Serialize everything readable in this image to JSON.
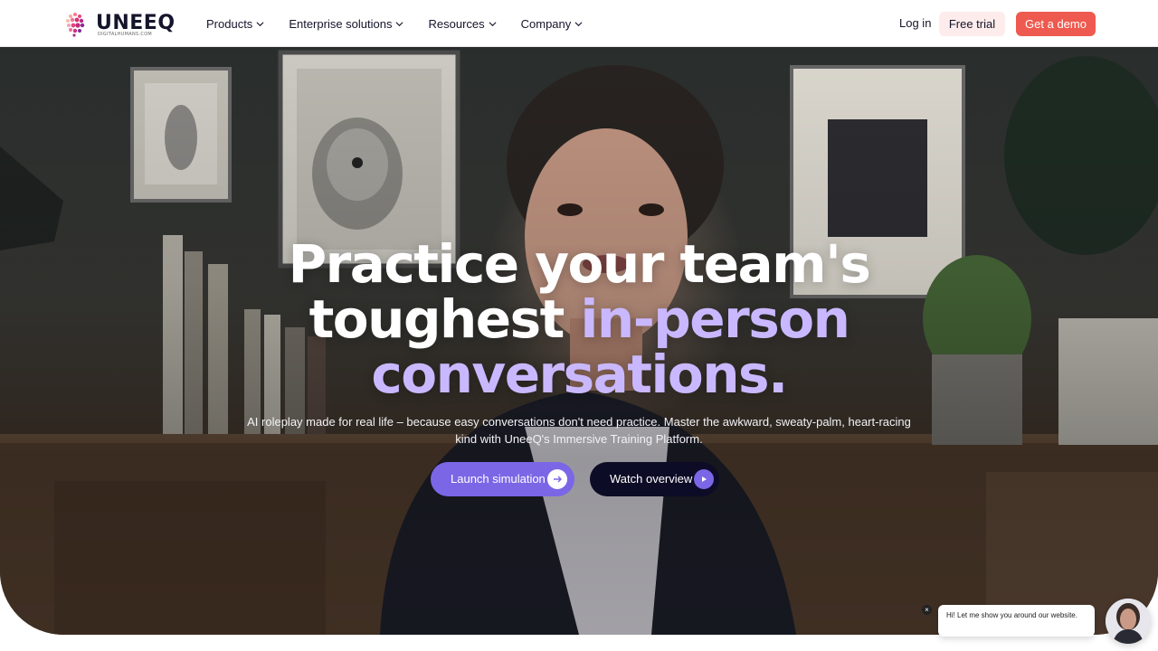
{
  "brand": {
    "name": "UNEEQ",
    "tagline": "DIGITALHUMANS.COM"
  },
  "nav": {
    "items": [
      {
        "label": "Products"
      },
      {
        "label": "Enterprise solutions"
      },
      {
        "label": "Resources"
      },
      {
        "label": "Company"
      }
    ],
    "login": "Log in",
    "free_trial": "Free trial",
    "demo": "Get a demo"
  },
  "hero": {
    "headline_line1": "Practice your team's",
    "headline_line2a": "toughest ",
    "headline_line2b": "in-person",
    "headline_line3": "conversations.",
    "subtext": "AI roleplay made for real life – because easy conversations don't need practice. Master the awkward, sweaty-palm, heart-racing kind with UneeQ's Immersive Training Platform.",
    "primary_cta": "Launch simulation",
    "secondary_cta": "Watch overview"
  },
  "chat": {
    "message": "Hi! Let me show you around our website.",
    "close": "×"
  },
  "colors": {
    "accent_purple": "#7b66e6",
    "demo_red": "#ee5a4f",
    "headline_accent": "#c9b8ff",
    "dark_button": "#0d0c26"
  }
}
